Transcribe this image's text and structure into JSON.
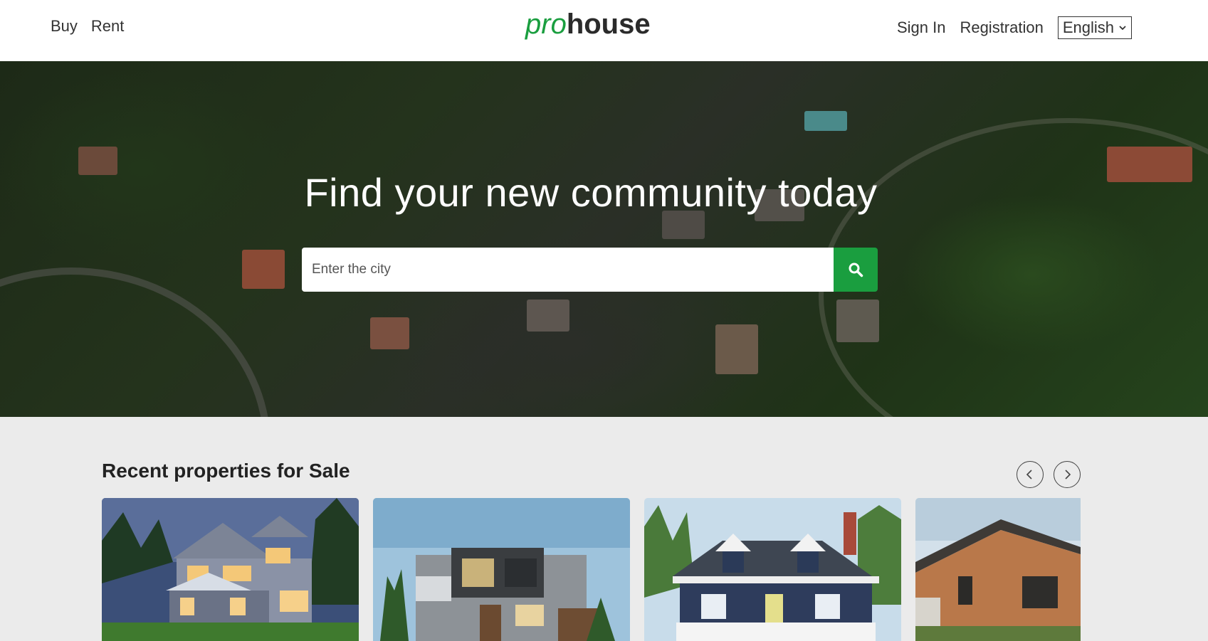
{
  "header": {
    "nav_left": [
      "Buy",
      "Rent"
    ],
    "logo": {
      "pro": "pro",
      "house": "house"
    },
    "sign_in": "Sign In",
    "registration": "Registration",
    "language": "English"
  },
  "hero": {
    "title": "Find your new community today",
    "search_placeholder": "Enter the city"
  },
  "recent": {
    "title": "Recent properties for Sale",
    "cards": [
      {
        "name": "craftsman-house-photo"
      },
      {
        "name": "modern-house-photo"
      },
      {
        "name": "blue-cottage-photo"
      },
      {
        "name": "wood-modern-house-photo"
      }
    ]
  },
  "colors": {
    "brand_green": "#1a9e3f",
    "dark_text": "#2b2b2b",
    "section_bg": "#ebebeb"
  }
}
